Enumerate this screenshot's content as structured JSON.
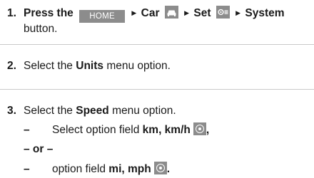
{
  "step1": {
    "number": "1.",
    "text_press": "Press the",
    "home_label": "HOME",
    "car_label": "Car",
    "set_label": "Set",
    "system_label": "System",
    "continuation": "button.",
    "icons": [
      "car-icon",
      "settings-list-icon"
    ]
  },
  "step2": {
    "number": "2.",
    "text_before": "Select the",
    "option": "Units",
    "text_after": "menu option."
  },
  "step3": {
    "number": "3.",
    "text_before": "Select the",
    "option": "Speed",
    "text_after": "menu option.",
    "dash": "–",
    "sub1_text": "Select option field",
    "sub1_value": "km, km/h",
    "sub1_trailing": ",",
    "or_label": "– or –",
    "sub2_text": "option field",
    "sub2_value": "mi, mph",
    "sub2_trailing": "."
  },
  "colors": {
    "button_bg": "#8c8c8c",
    "separator": "#c9c9c9",
    "text": "#1a1a1a"
  }
}
